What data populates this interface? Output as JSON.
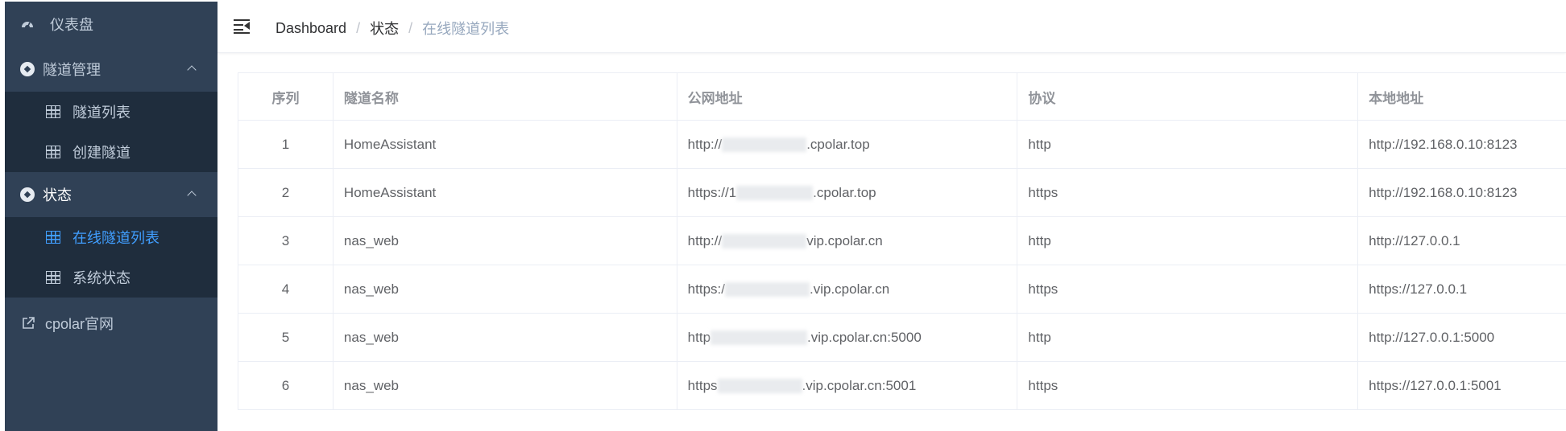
{
  "sidebar": {
    "items": [
      {
        "label": "仪表盘",
        "icon": "dashboard-icon"
      },
      {
        "label": "隧道管理",
        "icon": "tunnel-management-icon"
      },
      {
        "label": "隧道列表",
        "icon": "table-grid-icon"
      },
      {
        "label": "创建隧道",
        "icon": "table-grid-icon"
      },
      {
        "label": "状态",
        "icon": "status-icon"
      },
      {
        "label": "在线隧道列表",
        "icon": "table-grid-icon"
      },
      {
        "label": "系统状态",
        "icon": "table-grid-icon"
      },
      {
        "label": "cpolar官网",
        "icon": "external-link-icon"
      }
    ]
  },
  "breadcrumb": {
    "items": [
      "Dashboard",
      "状态",
      "在线隧道列表"
    ],
    "separator": "/"
  },
  "table": {
    "headers": [
      "序列",
      "隧道名称",
      "公网地址",
      "协议",
      "本地地址"
    ],
    "rows": [
      {
        "index": "1",
        "name": "HomeAssistant",
        "public_prefix": "http://",
        "public_suffix": ".cpolar.top",
        "protocol": "http",
        "local": "http://192.168.0.10:8123"
      },
      {
        "index": "2",
        "name": "HomeAssistant",
        "public_prefix": "https://1",
        "public_suffix": ".cpolar.top",
        "protocol": "https",
        "local": "http://192.168.0.10:8123"
      },
      {
        "index": "3",
        "name": "nas_web",
        "public_prefix": "http://",
        "public_suffix": "vip.cpolar.cn",
        "protocol": "http",
        "local": "http://127.0.0.1"
      },
      {
        "index": "4",
        "name": "nas_web",
        "public_prefix": "https:/",
        "public_suffix": ".vip.cpolar.cn",
        "protocol": "https",
        "local": "https://127.0.0.1"
      },
      {
        "index": "5",
        "name": "nas_web",
        "public_prefix": "http",
        "public_suffix": ".vip.cpolar.cn:5000",
        "protocol": "http",
        "local": "http://127.0.0.1:5000"
      },
      {
        "index": "6",
        "name": "nas_web",
        "public_prefix": "https",
        "public_suffix": ".vip.cpolar.cn:5001",
        "protocol": "https",
        "local": "https://127.0.0.1:5001"
      }
    ]
  },
  "colors": {
    "sidebar_bg": "#304156",
    "submenu_bg": "#1f2d3d",
    "active": "#409eff",
    "menu_text": "#bfcbd9"
  }
}
